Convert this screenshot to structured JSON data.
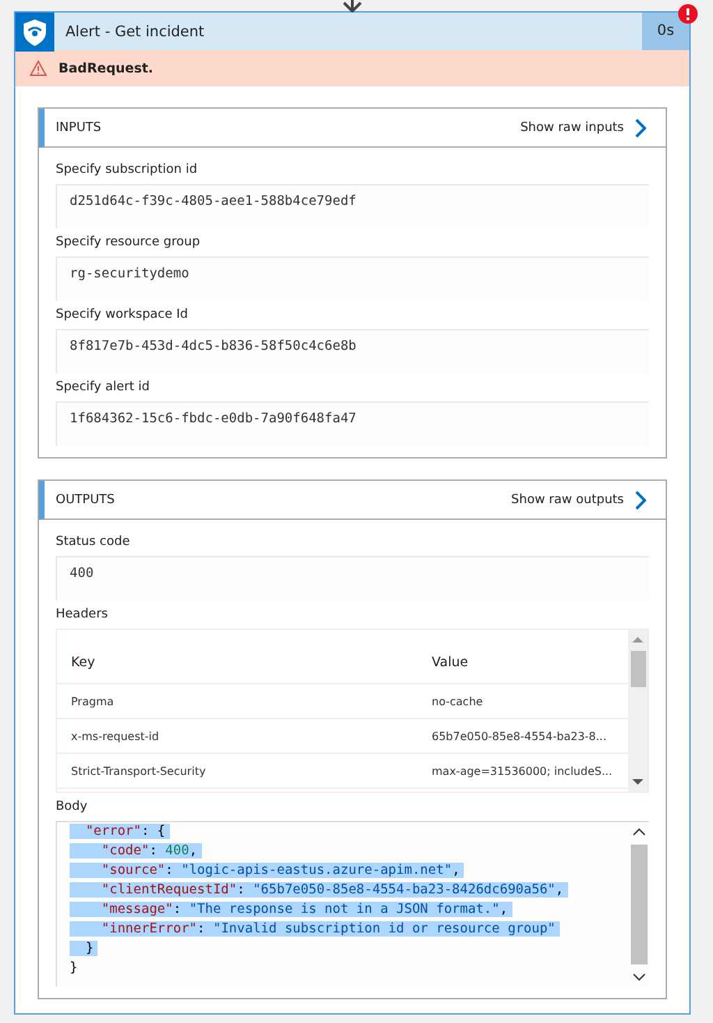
{
  "action": {
    "title": "Alert - Get incident",
    "duration": "0s",
    "failed": true,
    "error": "BadRequest."
  },
  "inputs": {
    "heading": "INPUTS",
    "raw_link": "Show raw inputs",
    "fields": [
      {
        "label": "Specify subscription id",
        "value": "d251d64c-f39c-4805-aee1-588b4ce79edf"
      },
      {
        "label": "Specify resource group",
        "value": "rg-securitydemo"
      },
      {
        "label": "Specify workspace Id",
        "value": "8f817e7b-453d-4dc5-b836-58f50c4c6e8b"
      },
      {
        "label": "Specify alert id",
        "value": "1f684362-15c6-fbdc-e0db-7a90f648fa47"
      }
    ]
  },
  "outputs": {
    "heading": "OUTPUTS",
    "raw_link": "Show raw outputs",
    "status": {
      "label": "Status code",
      "value": "400"
    },
    "headers": {
      "label": "Headers",
      "columns": [
        "Key",
        "Value"
      ],
      "rows": [
        [
          "Pragma",
          "no-cache"
        ],
        [
          "x-ms-request-id",
          "65b7e050-85e8-4554-ba23-8..."
        ],
        [
          "Strict-Transport-Security",
          "max-age=31536000; includeS..."
        ]
      ]
    },
    "body": {
      "label": "Body",
      "lines": [
        {
          "selected": true,
          "parts": [
            {
              "kind": "key",
              "text": "  \"error\""
            },
            {
              "kind": "punct",
              "text": ": {"
            }
          ]
        },
        {
          "selected": true,
          "parts": [
            {
              "kind": "key",
              "text": "    \"code\""
            },
            {
              "kind": "punct",
              "text": ": "
            },
            {
              "kind": "number",
              "text": "400"
            },
            {
              "kind": "punct",
              "text": ","
            }
          ]
        },
        {
          "selected": true,
          "parts": [
            {
              "kind": "key",
              "text": "    \"source\""
            },
            {
              "kind": "punct",
              "text": ": "
            },
            {
              "kind": "string",
              "text": "\"logic-apis-eastus.azure-apim.net\""
            },
            {
              "kind": "punct",
              "text": ","
            }
          ]
        },
        {
          "selected": true,
          "parts": [
            {
              "kind": "key",
              "text": "    \"clientRequestId\""
            },
            {
              "kind": "punct",
              "text": ": "
            },
            {
              "kind": "string",
              "text": "\"65b7e050-85e8-4554-ba23-8426dc690a56\""
            },
            {
              "kind": "punct",
              "text": ","
            }
          ]
        },
        {
          "selected": true,
          "parts": [
            {
              "kind": "key",
              "text": "    \"message\""
            },
            {
              "kind": "punct",
              "text": ": "
            },
            {
              "kind": "string",
              "text": "\"The response is not in a JSON format.\""
            },
            {
              "kind": "punct",
              "text": ","
            }
          ]
        },
        {
          "selected": true,
          "parts": [
            {
              "kind": "key",
              "text": "    \"innerError\""
            },
            {
              "kind": "punct",
              "text": ": "
            },
            {
              "kind": "string",
              "text": "\"Invalid subscription id or resource group\""
            }
          ]
        },
        {
          "selected": true,
          "parts": [
            {
              "kind": "punct",
              "text": "  }"
            }
          ]
        },
        {
          "selected": false,
          "parts": [
            {
              "kind": "punct",
              "text": "}"
            }
          ]
        }
      ]
    }
  }
}
